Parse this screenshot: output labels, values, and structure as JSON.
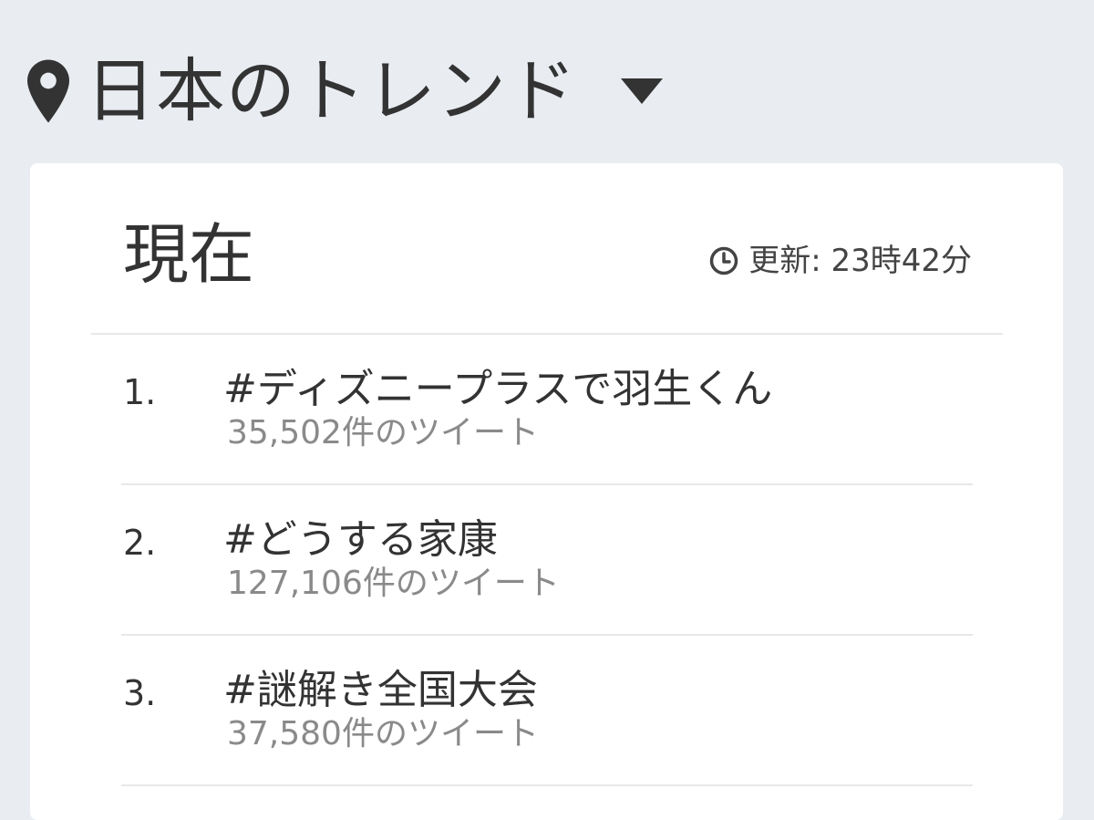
{
  "header": {
    "title": "日本のトレンド",
    "location_icon": "map-pin-icon",
    "dropdown_icon": "caret-down-icon"
  },
  "card": {
    "title": "現在",
    "updated_label": "更新: 23時42分",
    "clock_icon": "clock-icon"
  },
  "trends": [
    {
      "rank": "1.",
      "name": "#ディズニープラスで羽生くん",
      "count": "35,502件のツイート"
    },
    {
      "rank": "2.",
      "name": "#どうする家康",
      "count": "127,106件のツイート"
    },
    {
      "rank": "3.",
      "name": "#謎解き全国大会",
      "count": "37,580件のツイート"
    }
  ],
  "colors": {
    "page_background": "#e9edf2",
    "card_background": "#ffffff",
    "primary_text": "#333333",
    "secondary_text": "#8a8a8a"
  }
}
